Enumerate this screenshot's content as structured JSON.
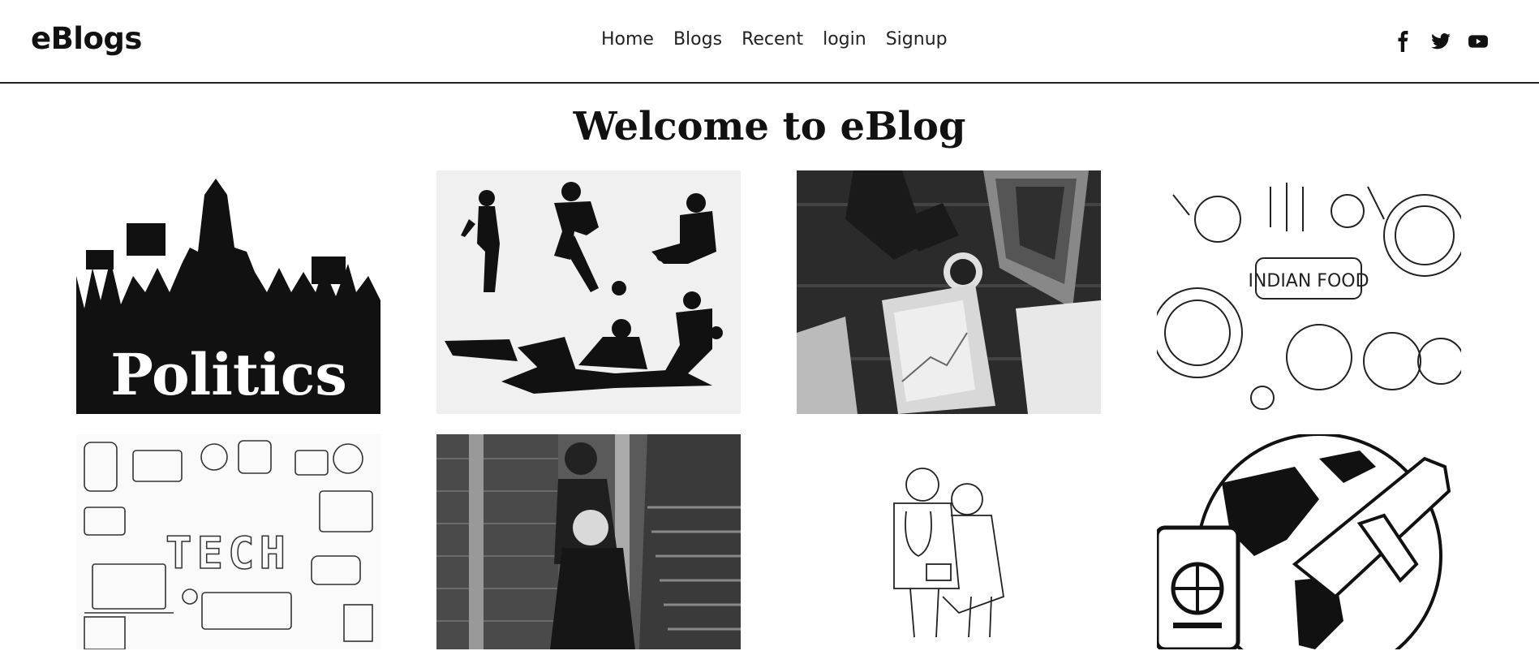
{
  "brand": "eBlogs",
  "nav": {
    "items": [
      "Home",
      "Blogs",
      "Recent",
      "login",
      "Signup"
    ]
  },
  "social": {
    "icons": [
      "facebook-icon",
      "twitter-icon",
      "youtube-icon"
    ]
  },
  "page_title": "Welcome to eBlog",
  "tiles": [
    {
      "topic": "politics",
      "caption": "Politics"
    },
    {
      "topic": "sports"
    },
    {
      "topic": "business"
    },
    {
      "topic": "food",
      "caption": "INDIAN FOOD"
    },
    {
      "topic": "tech",
      "caption": "TECH"
    },
    {
      "topic": "lifestyle"
    },
    {
      "topic": "health"
    },
    {
      "topic": "travel"
    }
  ]
}
